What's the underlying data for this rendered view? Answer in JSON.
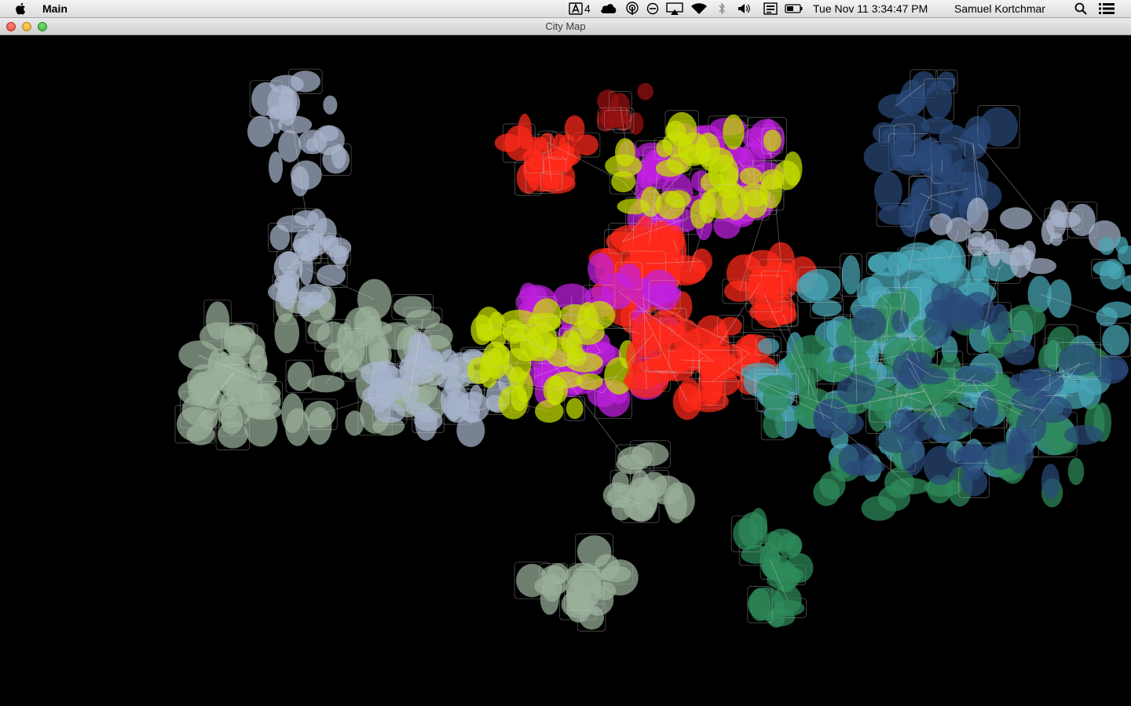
{
  "menubar": {
    "app_name": "Main",
    "status_items": {
      "notification_count": "4",
      "clock": "Tue Nov 11  3:34:47 PM",
      "user_name": "Samuel Kortchmar"
    },
    "icons": [
      "apple-icon",
      "adobe-icon",
      "cloud-icon",
      "podcast-icon",
      "do-not-disturb-icon",
      "airplay-icon",
      "wifi-icon",
      "bluetooth-icon",
      "volume-icon",
      "input-source-icon",
      "battery-icon",
      "spotlight-icon",
      "notification-center-icon"
    ]
  },
  "window": {
    "title": "City Map",
    "buttons": [
      "close",
      "minimize",
      "zoom"
    ]
  },
  "map": {
    "background": "#000000",
    "cluster_colors": {
      "red": "#ff2a1a",
      "magenta": "#c020e0",
      "yellow": "#c8e000",
      "pale_blue": "#a8b4cc",
      "sage": "#9ab09a",
      "teal": "#4aa8b8",
      "green": "#2e8a5a",
      "navy": "#2a4a7a",
      "dark_red": "#9a1010"
    }
  }
}
